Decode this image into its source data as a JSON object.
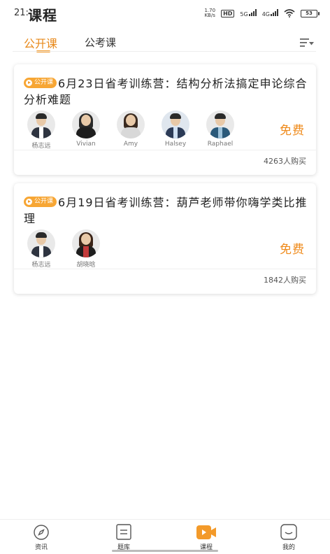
{
  "status_bar": {
    "time": "21:",
    "speed_value": "1.70",
    "speed_unit": "KB/s",
    "hd": "HD",
    "net_5g": "5G",
    "net_4g": "4G",
    "battery": "53"
  },
  "header": {
    "title": "课程"
  },
  "tabs": [
    {
      "label": "公开课",
      "active": true
    },
    {
      "label": "公考课",
      "active": false
    }
  ],
  "courses": [
    {
      "badge": "公开课",
      "title": "6月23日省考训练营：结构分析法搞定申论综合分析难题",
      "teachers": [
        {
          "name": "杨志远"
        },
        {
          "name": "Vivian"
        },
        {
          "name": "Amy"
        },
        {
          "name": "Halsey"
        },
        {
          "name": "Raphael"
        }
      ],
      "price": "免费",
      "purchases": "4263人购买"
    },
    {
      "badge": "公开课",
      "title": "6月19日省考训练营：葫芦老师带你嗨学类比推理",
      "teachers": [
        {
          "name": "杨志远"
        },
        {
          "name": "胡晓晗"
        }
      ],
      "price": "免费",
      "purchases": "1842人购买"
    }
  ],
  "bottom_nav": [
    {
      "label": "资讯",
      "icon": "compass-icon"
    },
    {
      "label": "题库",
      "icon": "question-bank-icon"
    },
    {
      "label": "课程",
      "icon": "video-course-icon",
      "active": true
    },
    {
      "label": "我的",
      "icon": "profile-icon"
    }
  ],
  "colors": {
    "accent": "#ef8a1a",
    "badge": "#f7a634"
  }
}
